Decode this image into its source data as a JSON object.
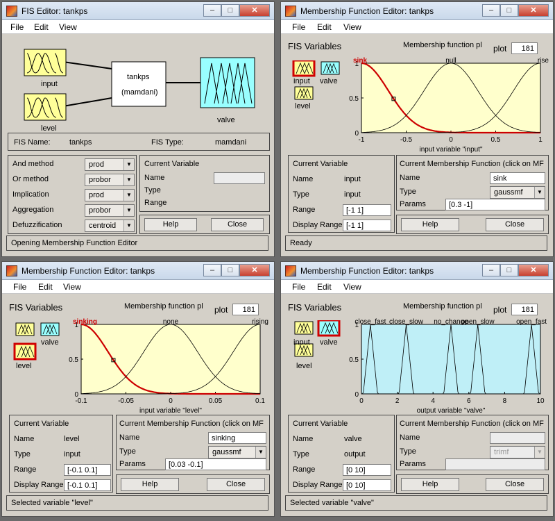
{
  "w1": {
    "title": "FIS Editor: tankps",
    "menu": [
      "File",
      "Edit",
      "View"
    ],
    "input_label": "input",
    "level_label": "level",
    "system_name": "tankps",
    "system_type": "(mamdani)",
    "output_label": "valve",
    "fis_name_label": "FIS Name:",
    "fis_name": "tankps",
    "fis_type_label": "FIS Type:",
    "fis_type": "mamdani",
    "methods": [
      {
        "label": "And method",
        "value": "prod"
      },
      {
        "label": "Or method",
        "value": "probor"
      },
      {
        "label": "Implication",
        "value": "prod"
      },
      {
        "label": "Aggregation",
        "value": "probor"
      },
      {
        "label": "Defuzzification",
        "value": "centroid"
      }
    ],
    "cv_title": "Current Variable",
    "cv_name": "Name",
    "cv_type": "Type",
    "cv_range": "Range",
    "help": "Help",
    "close": "Close",
    "status": "Opening Membership Function Editor"
  },
  "w2": {
    "title": "Membership Function Editor: tankps",
    "menu": [
      "File",
      "Edit",
      "View"
    ],
    "fisvars": "FIS Variables",
    "in1": "input",
    "out1": "valve",
    "in2": "level",
    "plot_title": "Membership function pl",
    "plot_label": "plot",
    "plot_points": "181",
    "mf_names": [
      "sink",
      "null",
      "rise"
    ],
    "xlabel": "input variable \"input\"",
    "xticks": [
      "-1",
      "-0.5",
      "0",
      "0.5",
      "1"
    ],
    "yticks": [
      "0",
      "0.5",
      "1"
    ],
    "cv_title": "Current Variable",
    "name_label": "Name",
    "name_value": "input",
    "type_label": "Type",
    "type_value": "input",
    "range_label": "Range",
    "range_value": "[-1 1]",
    "drange_label": "Display Range",
    "drange_value": "[-1 1]",
    "cmf_title": "Current Membership Function (click on MF",
    "mf_name_label": "Name",
    "mf_name": "sink",
    "mf_type_label": "Type",
    "mf_type": "gaussmf",
    "params_label": "Params",
    "params": "[0.3 -1]",
    "help": "Help",
    "close": "Close",
    "status": "Ready"
  },
  "w3": {
    "title": "Membership Function Editor: tankps",
    "menu": [
      "File",
      "Edit",
      "View"
    ],
    "fisvars": "FIS Variables",
    "in1": "input",
    "out1": "valve",
    "in2": "level",
    "plot_title": "Membership function pl",
    "plot_label": "plot",
    "plot_points": "181",
    "mf_names": [
      "sinking",
      "none",
      "rising"
    ],
    "xlabel": "input variable \"level\"",
    "xticks": [
      "-0.1",
      "-0.05",
      "0",
      "0.05",
      "0.1"
    ],
    "yticks": [
      "0",
      "0.5",
      "1"
    ],
    "cv_title": "Current Variable",
    "name_label": "Name",
    "name_value": "level",
    "type_label": "Type",
    "type_value": "input",
    "range_label": "Range",
    "range_value": "[-0.1 0.1]",
    "drange_label": "Display Range",
    "drange_value": "[-0.1 0.1]",
    "cmf_title": "Current Membership Function (click on MF",
    "mf_name_label": "Name",
    "mf_name": "sinking",
    "mf_type_label": "Type",
    "mf_type": "gaussmf",
    "params_label": "Params",
    "params": "[0.03 -0.1]",
    "help": "Help",
    "close": "Close",
    "status": "Selected variable \"level\""
  },
  "w4": {
    "title": "Membership Function Editor: tankps",
    "menu": [
      "File",
      "Edit",
      "View"
    ],
    "fisvars": "FIS Variables",
    "in1": "input",
    "out1": "valve",
    "in2": "level",
    "plot_title": "Membership function pl",
    "plot_label": "plot",
    "plot_points": "181",
    "mf_names": [
      "close_fast",
      "close_slow",
      "no_change",
      "open_slow",
      "open_fast"
    ],
    "xlabel": "output variable \"valve\"",
    "xticks": [
      "0",
      "2",
      "4",
      "6",
      "8",
      "10"
    ],
    "yticks": [
      "0",
      "0.5",
      "1"
    ],
    "cv_title": "Current Variable",
    "name_label": "Name",
    "name_value": "valve",
    "type_label": "Type",
    "type_value": "output",
    "range_label": "Range",
    "range_value": "[0 10]",
    "drange_label": "Display Range",
    "drange_value": "[0 10]",
    "cmf_title": "Current Membership Function (click on MF",
    "mf_name_label": "Name",
    "mf_name": "",
    "mf_type_label": "Type",
    "mf_type": "trimf",
    "params_label": "Params",
    "params": "",
    "help": "Help",
    "close": "Close",
    "status": "Selected variable \"valve\""
  },
  "chart_data": [
    {
      "type": "line",
      "window": "w2",
      "xlim": [
        -1,
        1
      ],
      "ylim": [
        0,
        1
      ],
      "series": [
        {
          "name": "sink",
          "mf": "gaussmf",
          "params": [
            0.3,
            -1
          ]
        },
        {
          "name": "null",
          "mf": "gaussmf",
          "params": [
            0.3,
            0
          ]
        },
        {
          "name": "rise",
          "mf": "gaussmf",
          "params": [
            0.3,
            1
          ]
        }
      ],
      "selected": "sink"
    },
    {
      "type": "line",
      "window": "w3",
      "xlim": [
        -0.1,
        0.1
      ],
      "ylim": [
        0,
        1
      ],
      "series": [
        {
          "name": "sinking",
          "mf": "gaussmf",
          "params": [
            0.03,
            -0.1
          ]
        },
        {
          "name": "none",
          "mf": "gaussmf",
          "params": [
            0.03,
            0
          ]
        },
        {
          "name": "rising",
          "mf": "gaussmf",
          "params": [
            0.03,
            0.1
          ]
        }
      ],
      "selected": "sinking"
    },
    {
      "type": "line",
      "window": "w4",
      "xlim": [
        0,
        10
      ],
      "ylim": [
        0,
        1
      ],
      "series": [
        {
          "name": "close_fast",
          "mf": "trimf",
          "params": [
            0.1,
            0.5,
            0.9
          ]
        },
        {
          "name": "close_slow",
          "mf": "trimf",
          "params": [
            2.1,
            2.5,
            2.9
          ]
        },
        {
          "name": "no_change",
          "mf": "trimf",
          "params": [
            4.6,
            5,
            5.4
          ]
        },
        {
          "name": "open_slow",
          "mf": "trimf",
          "params": [
            6.1,
            6.5,
            6.9
          ]
        },
        {
          "name": "open_fast",
          "mf": "trimf",
          "params": [
            9.1,
            9.5,
            9.9
          ]
        }
      ],
      "selected": ""
    }
  ],
  "colors": {
    "plot_bg_yellow": "#ffffcc",
    "plot_bg_cyan": "#bfeff7",
    "selected_curve": "#cc0000",
    "curve": "#000000",
    "input_box": "#ffff99",
    "output_box": "#99ffff",
    "highlight": "#d00000"
  }
}
